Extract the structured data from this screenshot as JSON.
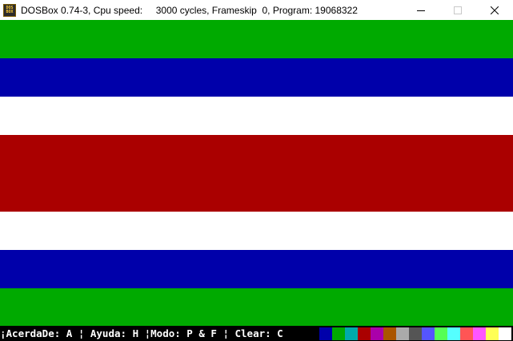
{
  "window": {
    "title": "DOSBox 0.74-3, Cpu speed:     3000 cycles, Frameskip  0, Program: 19068322",
    "icon": "dosbox-icon",
    "icon_text_top": "DOS",
    "icon_text_bottom": "BOX",
    "controls": [
      "minimize-icon",
      "maximize-icon",
      "close-icon"
    ]
  },
  "flag": {
    "stripe_colors": [
      "#00aa00",
      "#0000aa",
      "#ffffff",
      "#aa0000",
      "#aa0000",
      "#ffffff",
      "#0000aa",
      "#00aa00"
    ]
  },
  "statusbar": {
    "text": "¡AcerdaDe: A ¦ Ayuda: H ¦Modo: P & F ¦ Clear: C",
    "palette": [
      "#000000",
      "#0000aa",
      "#00aa00",
      "#00aaaa",
      "#aa0000",
      "#aa00aa",
      "#aa5500",
      "#aaaaaa",
      "#555555",
      "#5555ff",
      "#55ff55",
      "#55ffff",
      "#ff5555",
      "#ff55ff",
      "#ffff55",
      "#ffffff"
    ]
  }
}
